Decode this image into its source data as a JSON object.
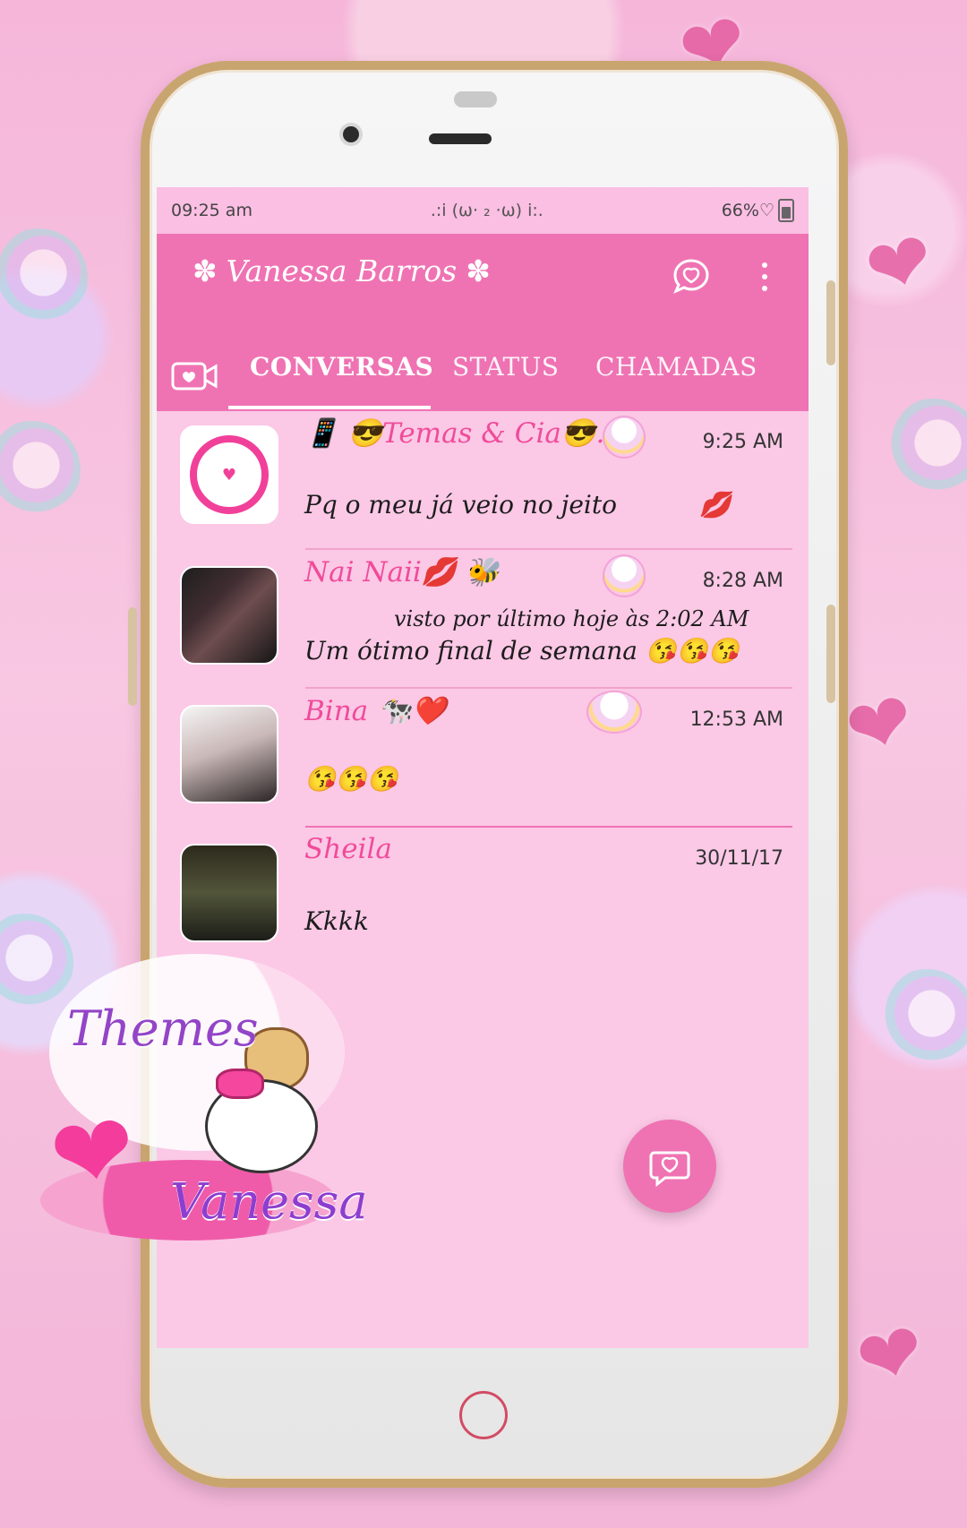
{
  "status_bar": {
    "time": "09:25 am",
    "center": ".:i (ω· ₂ ·ω) i:.",
    "battery": "66%♡"
  },
  "header": {
    "title": "Vanessa Barros",
    "title_decoration": "✽"
  },
  "tabs": [
    {
      "label": "CONVERSAS",
      "active": true
    },
    {
      "label": "STATUS",
      "active": false
    },
    {
      "label": "CHAMADAS",
      "active": false
    }
  ],
  "chats": [
    {
      "name": "📱 😎Temas & Cia😎...",
      "time": "9:25 AM",
      "message": "Pq o meu já veio no jeito",
      "extra": "💋"
    },
    {
      "name": "Nai Naii💋 🐝",
      "time": "8:28 AM",
      "submessage": "visto por último hoje às 2:02 AM",
      "message": "Um ótimo final de semana 😘😘😘"
    },
    {
      "name": "Bina 🐄❤️",
      "time": "12:53 AM",
      "message": "😘😘😘"
    },
    {
      "name": "Sheila",
      "time": "30/11/17",
      "message": "Kkkk"
    }
  ],
  "badge": {
    "line1": "Themes",
    "line2": "Vanessa"
  },
  "icons": {
    "new_chat": "heart-chat-icon",
    "menu": "more-vert-icon",
    "camera": "camera-heart-icon",
    "home": "home-button-icon"
  },
  "colors": {
    "accent": "#ef73b3",
    "screen_bg": "#fbc8e6",
    "frame_gold": "#c8a56e"
  }
}
